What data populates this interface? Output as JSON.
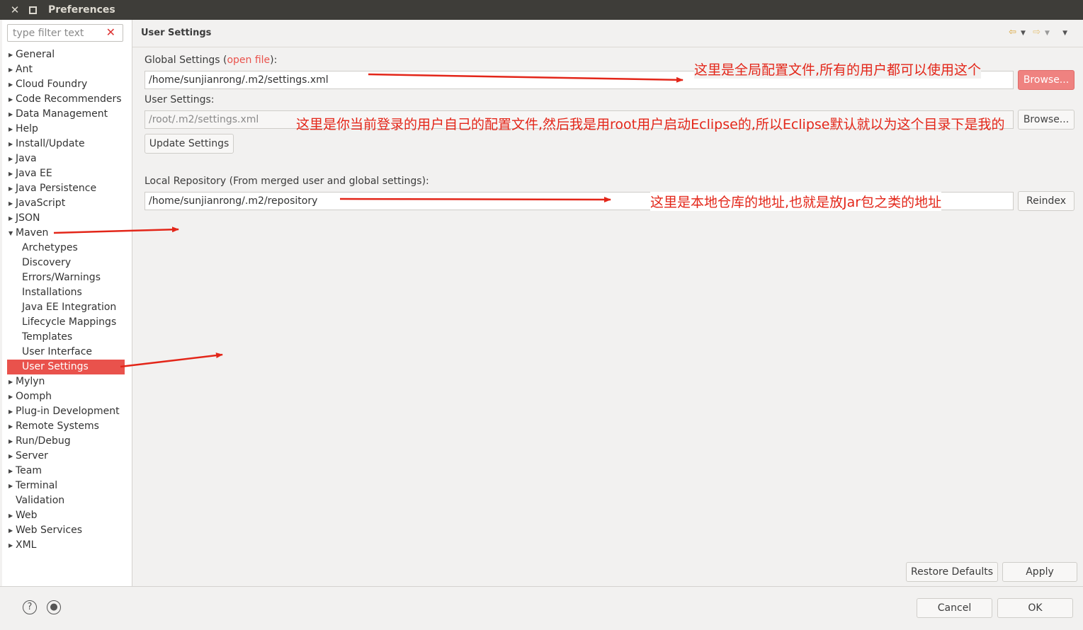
{
  "window": {
    "title": "Preferences"
  },
  "filter": {
    "placeholder": "type filter text"
  },
  "tree": [
    {
      "label": "General",
      "expandable": true
    },
    {
      "label": "Ant",
      "expandable": true
    },
    {
      "label": "Cloud Foundry",
      "expandable": true
    },
    {
      "label": "Code Recommenders",
      "expandable": true
    },
    {
      "label": "Data Management",
      "expandable": true
    },
    {
      "label": "Help",
      "expandable": true
    },
    {
      "label": "Install/Update",
      "expandable": true
    },
    {
      "label": "Java",
      "expandable": true
    },
    {
      "label": "Java EE",
      "expandable": true
    },
    {
      "label": "Java Persistence",
      "expandable": true
    },
    {
      "label": "JavaScript",
      "expandable": true
    },
    {
      "label": "JSON",
      "expandable": true
    },
    {
      "label": "Maven",
      "expandable": true,
      "expanded": true
    },
    {
      "label": "Archetypes",
      "child": true
    },
    {
      "label": "Discovery",
      "child": true
    },
    {
      "label": "Errors/Warnings",
      "child": true
    },
    {
      "label": "Installations",
      "child": true
    },
    {
      "label": "Java EE Integration",
      "child": true
    },
    {
      "label": "Lifecycle Mappings",
      "child": true
    },
    {
      "label": "Templates",
      "child": true
    },
    {
      "label": "User Interface",
      "child": true
    },
    {
      "label": "User Settings",
      "child": true,
      "selected": true
    },
    {
      "label": "Mylyn",
      "expandable": true
    },
    {
      "label": "Oomph",
      "expandable": true
    },
    {
      "label": "Plug-in Development",
      "expandable": true
    },
    {
      "label": "Remote Systems",
      "expandable": true
    },
    {
      "label": "Run/Debug",
      "expandable": true
    },
    {
      "label": "Server",
      "expandable": true
    },
    {
      "label": "Team",
      "expandable": true
    },
    {
      "label": "Terminal",
      "expandable": true
    },
    {
      "label": "Validation",
      "expandable": false
    },
    {
      "label": "Web",
      "expandable": true
    },
    {
      "label": "Web Services",
      "expandable": true
    },
    {
      "label": "XML",
      "expandable": true
    }
  ],
  "page": {
    "title": "User Settings",
    "global_label_pre": "Global Settings (",
    "global_link": "open file",
    "global_label_post": "):",
    "global_value": "/home/sunjianrong/.m2/settings.xml",
    "browse_label": "Browse...",
    "user_label": "User Settings:",
    "user_value": "/root/.m2/settings.xml",
    "user_browse_label": "Browse...",
    "update_label": "Update Settings",
    "local_label": "Local Repository (From merged user and global settings):",
    "local_value": "/home/sunjianrong/.m2/repository",
    "reindex_label": "Reindex",
    "restore_label": "Restore Defaults",
    "apply_label": "Apply"
  },
  "annotations": {
    "global": "这里是全局配置文件,所有的用户都可以使用这个",
    "user": "这里是你当前登录的用户自己的配置文件,然后我是用root用户启动Eclipse的,所以Eclipse默认就以为这个目录下是我的",
    "local": "这里是本地仓库的地址,也就是放Jar包之类的地址"
  },
  "footer": {
    "cancel_label": "Cancel",
    "ok_label": "OK"
  },
  "colors": {
    "accent": "#e9524c",
    "annotation": "#e32619",
    "titlebar": "#3e3d39"
  }
}
